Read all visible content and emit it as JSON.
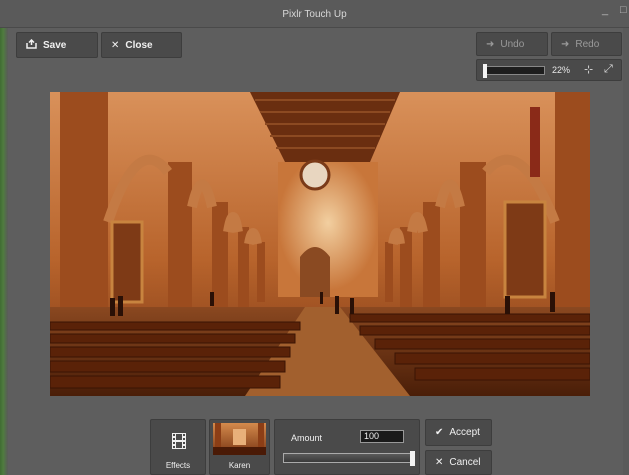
{
  "window": {
    "title": "Pixlr Touch Up",
    "minimize_glyph": "_",
    "maximize_glyph": "□"
  },
  "toolbar": {
    "save_label": "Save",
    "close_label": "Close",
    "undo_label": "Undo",
    "redo_label": "Redo"
  },
  "zoom": {
    "value": "22%",
    "level_fraction": 0.0
  },
  "image": {
    "subject": "church interior photo"
  },
  "bottom_panel": {
    "effects_label": "Effects",
    "preset_label": "Karen",
    "amount_label": "Amount",
    "amount_value": "100",
    "amount_fraction": 1.0,
    "accept_label": "Accept",
    "cancel_label": "Cancel"
  },
  "colors": {
    "panel": "#5e5e5e",
    "button": "#4a4a4a",
    "text": "#f0f0f0",
    "photo_tone": "#c8763a"
  }
}
